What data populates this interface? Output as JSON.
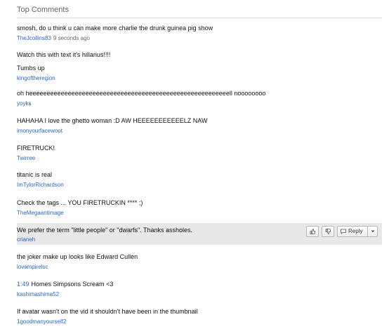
{
  "header": {
    "title": "Top Comments"
  },
  "comments": [
    {
      "text": "smosh, do u think u can make more charlie the drunk guinea pig show",
      "username": "TheJcollins83",
      "time": "9 seconds ago"
    },
    {
      "text": "Watch this with text it's hillarius!!!!"
    },
    {
      "text": "Tumbs up",
      "username": "kingoftheregion"
    },
    {
      "text": "oh heeeeeeeeeeeeeeeeeeeeeeeeeeeeeeeeeeeeeeeeeeeeeeeeeeeeeeeeell noooooooo",
      "username": "yoyks"
    },
    {
      "text": "HAHAHA I love the ghetto woman :D AW HEEEEEEEEEEELZ NAW",
      "username": "imonyourfacewoot"
    },
    {
      "text": "FIRETRUCK!",
      "username": "Twirree"
    },
    {
      "text": "titanic is real",
      "username": "ImTylorRichardson"
    },
    {
      "text": "Check the tags ... YOU FIRETRUCKIN **** ;)",
      "username": "TheMegaantimage"
    },
    {
      "text": "We prefer the term \"little people\" or \"dwarfs\". Thanks assholes.",
      "username": "crianeh",
      "actions": {
        "reply_label": "Reply"
      }
    },
    {
      "text": "the joker make up looks like Edward Cullen",
      "username": "lovampirelsc"
    },
    {
      "timestamp_link": "1:49",
      "text": "Homes Simpsons Scream <3",
      "username": "kashimashima52"
    },
    {
      "text": "If avatar wasn't on the vid it shouldn't have been in the thumbnail",
      "username": "1goodmanyourself2"
    }
  ],
  "icons": {
    "thumbs_up": "thumbs-up-icon",
    "thumbs_down": "thumbs-down-icon",
    "reply": "reply-icon",
    "dropdown": "chevron-down-icon"
  },
  "colors": {
    "link": "#2d64c5",
    "highlight": "#e8e8e8",
    "meta": "#666666"
  }
}
